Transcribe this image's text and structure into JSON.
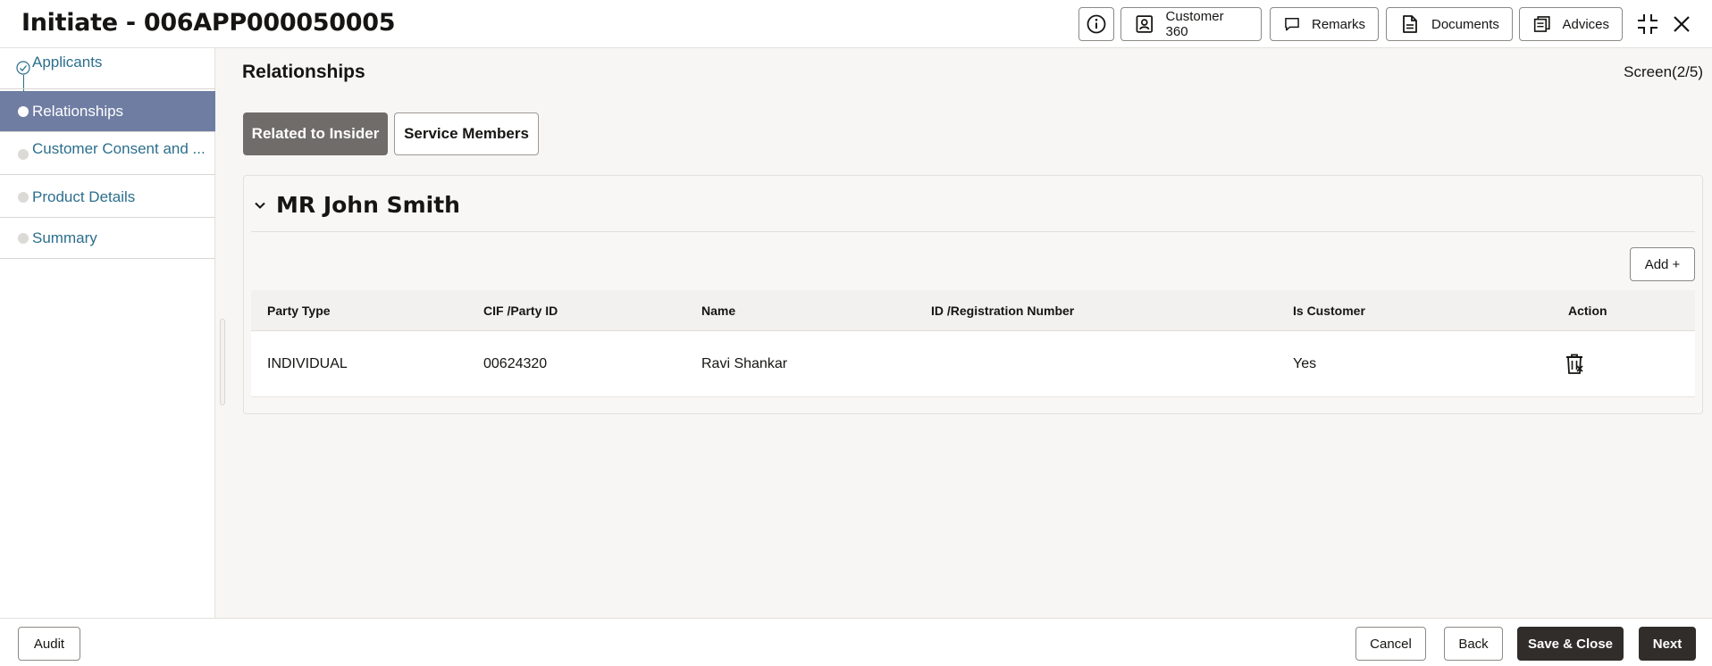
{
  "header": {
    "title": "Initiate - 006APP000050005",
    "buttons": {
      "customer360": "Customer 360",
      "remarks": "Remarks",
      "documents": "Documents",
      "advices": "Advices"
    }
  },
  "sidebar": {
    "steps": [
      {
        "label": "Applicants",
        "state": "done"
      },
      {
        "label": "Relationships",
        "state": "active"
      },
      {
        "label": "Customer Consent and ...",
        "state": "pending"
      },
      {
        "label": "Product Details",
        "state": "pending"
      },
      {
        "label": "Summary",
        "state": "pending"
      }
    ]
  },
  "main": {
    "title": "Relationships",
    "screen_indicator": "Screen(2/5)",
    "tabs": [
      {
        "label": "Related to Insider",
        "selected": true
      },
      {
        "label": "Service Members",
        "selected": false
      }
    ],
    "section": {
      "name": "MR John Smith",
      "add_label": "Add +",
      "table": {
        "headers": [
          "Party Type",
          "CIF /Party ID",
          "Name",
          "ID /Registration Number",
          "Is Customer",
          "Action"
        ],
        "rows": [
          {
            "party_type": "INDIVIDUAL",
            "cif": "00624320",
            "name": "Ravi Shankar",
            "id_reg": "",
            "is_customer": "Yes",
            "action_icon": "delete-icon"
          }
        ]
      }
    }
  },
  "footer": {
    "audit": "Audit",
    "cancel": "Cancel",
    "back": "Back",
    "save_close": "Save & Close",
    "next": "Next"
  },
  "colors": {
    "active_step": "#6f7da3",
    "link": "#2c6f8c",
    "primary_dark": "#312d2a",
    "selected_tab": "#6f6c69"
  }
}
